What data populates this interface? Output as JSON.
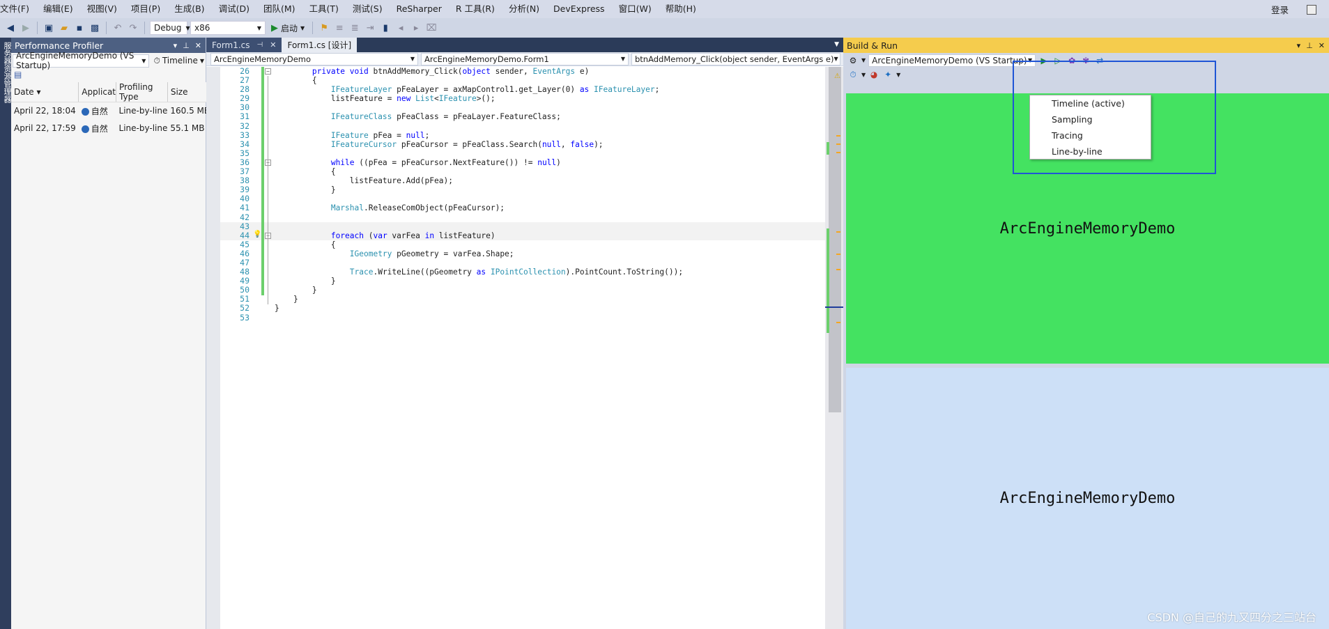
{
  "menu": [
    "文件(F)",
    "编辑(E)",
    "视图(V)",
    "项目(P)",
    "生成(B)",
    "调试(D)",
    "团队(M)",
    "工具(T)",
    "测试(S)",
    "ReSharper",
    "R 工具(R)",
    "分析(N)",
    "DevExpress",
    "窗口(W)",
    "帮助(H)"
  ],
  "login_label": "登录",
  "toolbar": {
    "config": "Debug",
    "platform": "x86",
    "start_label": "启动"
  },
  "left_strip_label": "服务器资源管理器",
  "perf": {
    "title": "Performance Profiler",
    "project": "ArcEngineMemoryDemo (VS Startup)",
    "mode": "Timeline",
    "columns": [
      "Date",
      "Applicat",
      "Profiling Type",
      "Size"
    ],
    "rows": [
      {
        "date": "April 22, 18:04",
        "app": "自然",
        "type": "Line-by-line",
        "size": "160.5 MB"
      },
      {
        "date": "April 22, 17:59",
        "app": "自然",
        "type": "Line-by-line",
        "size": "55.1 MB"
      }
    ]
  },
  "tabs": [
    {
      "label": "Form1.cs"
    },
    {
      "label": "Form1.cs [设计]"
    }
  ],
  "nav": {
    "project": "ArcEngineMemoryDemo",
    "class": "ArcEngineMemoryDemo.Form1",
    "member": "btnAddMemory_Click(object sender, EventArgs e)"
  },
  "code": [
    {
      "n": "26",
      "t": "        private void btnAddMemory_Click(object sender, EventArgs e)"
    },
    {
      "n": "27",
      "t": "        {"
    },
    {
      "n": "28",
      "t": "            IFeatureLayer pFeaLayer = axMapControl1.get_Layer(0) as IFeatureLayer;"
    },
    {
      "n": "29",
      "t": "            listFeature = new List<IFeature>();"
    },
    {
      "n": "30",
      "t": ""
    },
    {
      "n": "31",
      "t": "            IFeatureClass pFeaClass = pFeaLayer.FeatureClass;"
    },
    {
      "n": "32",
      "t": ""
    },
    {
      "n": "33",
      "t": "            IFeature pFea = null;"
    },
    {
      "n": "34",
      "t": "            IFeatureCursor pFeaCursor = pFeaClass.Search(null, false);"
    },
    {
      "n": "35",
      "t": ""
    },
    {
      "n": "36",
      "t": "            while ((pFea = pFeaCursor.NextFeature()) != null)"
    },
    {
      "n": "37",
      "t": "            {"
    },
    {
      "n": "38",
      "t": "                listFeature.Add(pFea);"
    },
    {
      "n": "39",
      "t": "            }"
    },
    {
      "n": "40",
      "t": ""
    },
    {
      "n": "41",
      "t": "            Marshal.ReleaseComObject(pFeaCursor);"
    },
    {
      "n": "42",
      "t": ""
    },
    {
      "n": "43",
      "t": ""
    },
    {
      "n": "44",
      "t": "            foreach (var varFea in listFeature)"
    },
    {
      "n": "45",
      "t": "            {"
    },
    {
      "n": "46",
      "t": "                IGeometry pGeometry = varFea.Shape;"
    },
    {
      "n": "47",
      "t": ""
    },
    {
      "n": "48",
      "t": "                Trace.WriteLine((pGeometry as IPointCollection).PointCount.ToString());"
    },
    {
      "n": "49",
      "t": "            }"
    },
    {
      "n": "50",
      "t": "        }"
    },
    {
      "n": "51",
      "t": "    }"
    },
    {
      "n": "52",
      "t": "}"
    },
    {
      "n": "53",
      "t": ""
    }
  ],
  "build": {
    "title": "Build & Run",
    "project": "ArcEngineMemoryDemo (VS Startup)",
    "green_text": "ArcEngineMemoryDemo",
    "blue_text": "ArcEngineMemoryDemo"
  },
  "profiler_menu": [
    "Timeline (active)",
    "Sampling",
    "Tracing",
    "Line-by-line"
  ],
  "watermark": "CSDN @自己的九又四分之三站台",
  "colors": {
    "accent_title": "#f5cc4d",
    "green_pane": "#44e261",
    "blue_pane": "#cde0f7",
    "highlight_box": "#1f55d6"
  }
}
